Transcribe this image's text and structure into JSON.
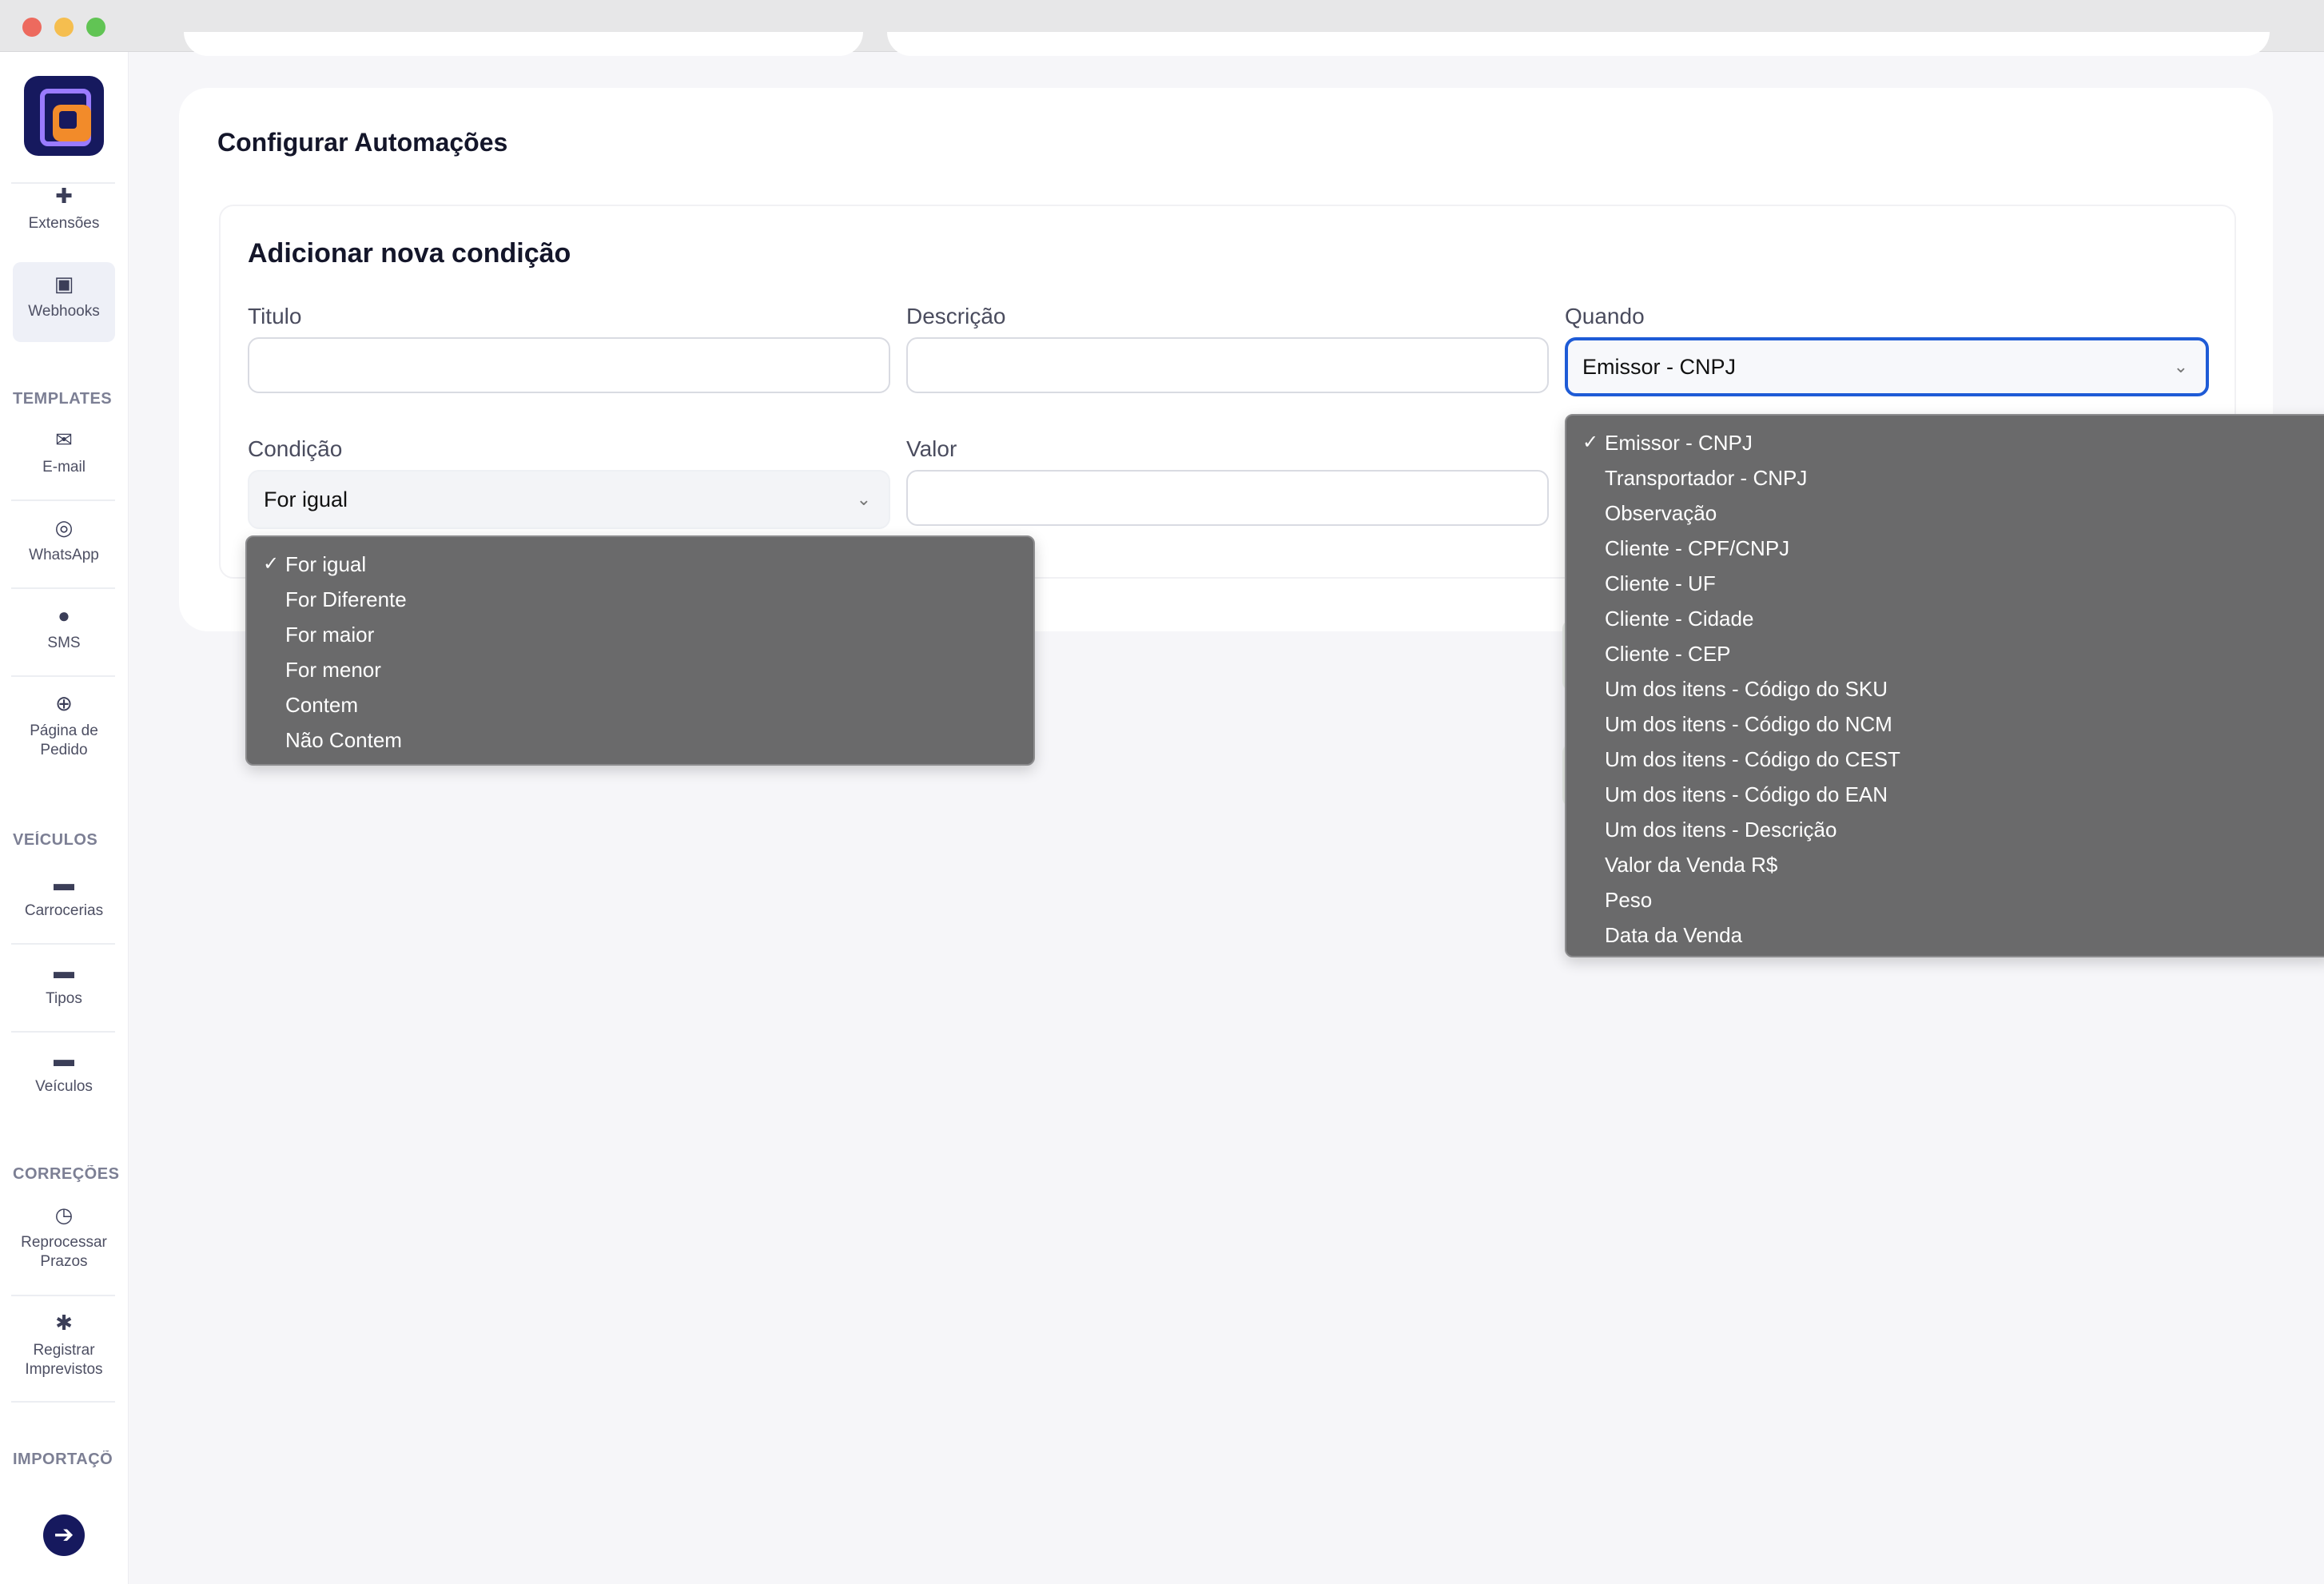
{
  "sidebar": {
    "items_top": [
      {
        "label": "Extensões",
        "icon": "puzzle-icon"
      },
      {
        "label": "Webhooks",
        "icon": "webhook-icon"
      }
    ],
    "sections": [
      {
        "heading": "TEMPLATES",
        "items": [
          {
            "label": "E-mail",
            "icon": "email-icon"
          },
          {
            "label": "WhatsApp",
            "icon": "whatsapp-icon"
          },
          {
            "label": "SMS",
            "icon": "sms-icon"
          },
          {
            "label": "Página de Pedido",
            "icon": "globe-icon"
          }
        ]
      },
      {
        "heading": "VEÍCULOS",
        "items": [
          {
            "label": "Carrocerias",
            "icon": "truck-icon"
          },
          {
            "label": "Tipos",
            "icon": "truck-icon"
          },
          {
            "label": "Veículos",
            "icon": "truck-icon"
          }
        ]
      },
      {
        "heading": "CORREÇÕES",
        "items": [
          {
            "label": "Reprocessar Prazos",
            "icon": "clock-icon"
          },
          {
            "label": "Registrar Imprevistos",
            "icon": "car-crash-icon"
          }
        ]
      },
      {
        "heading": "IMPORTAÇÕ",
        "items": []
      }
    ],
    "go_icon": "arrow-right-icon"
  },
  "main": {
    "card_title": "Configurar Automações",
    "form_title": "Adicionar nova condição",
    "fields": {
      "titulo": {
        "label": "Titulo",
        "value": ""
      },
      "descricao": {
        "label": "Descrição",
        "value": ""
      },
      "quando": {
        "label": "Quando",
        "value": "Emissor - CNPJ"
      },
      "condicao": {
        "label": "Condição",
        "value": "For igual"
      },
      "valor": {
        "label": "Valor",
        "value": ""
      }
    },
    "condicao_options": [
      "For igual",
      "For Diferente",
      "For maior",
      "For menor",
      "Contem",
      "Não Contem"
    ],
    "quando_options": [
      "Emissor - CNPJ",
      "Transportador - CNPJ",
      "Observação",
      "Cliente - CPF/CNPJ",
      "Cliente - UF",
      "Cliente - Cidade",
      "Cliente - CEP",
      "Um dos itens - Código do SKU",
      "Um dos itens - Código do NCM",
      "Um dos itens - Código do CEST",
      "Um dos itens - Código do EAN",
      "Um dos itens - Descrição",
      "Valor da Venda R$",
      "Peso",
      "Data da Venda"
    ],
    "selected_check": "✓"
  },
  "colors": {
    "accent": "#1e5bd6",
    "brand": "#16195e",
    "dropdown_bg": "#6a6a6b"
  }
}
